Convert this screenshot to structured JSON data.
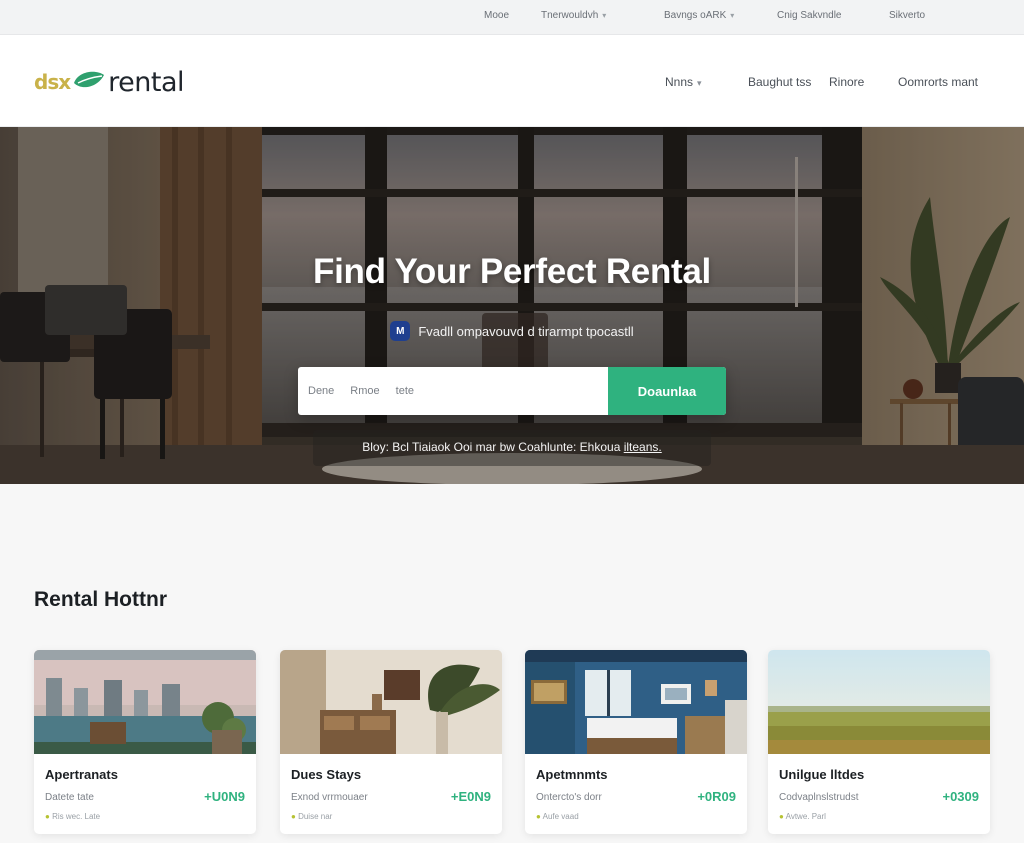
{
  "utility_bar": {
    "links": [
      {
        "label": "Mooe",
        "has_chevron": false
      },
      {
        "label": "Tnerwouldvh",
        "has_chevron": true
      },
      {
        "label": "Bavngs oARK",
        "has_chevron": true
      },
      {
        "label": "Cnig Sakvndle",
        "has_chevron": false
      },
      {
        "label": "Sikverto",
        "has_chevron": false
      }
    ]
  },
  "header": {
    "logo_prefix": "dsx",
    "logo_word": "rental",
    "nav": [
      {
        "label": "Nnns",
        "has_chevron": true
      },
      {
        "label": "Baughut tss",
        "has_chevron": false
      },
      {
        "label": "Rinore",
        "has_chevron": false
      },
      {
        "label": "Oomrorts mant",
        "has_chevron": false
      }
    ]
  },
  "hero": {
    "title": "Find Your Perfect Rental",
    "badge_letter": "M",
    "subtitle": "Fvadll  ompavouvd d  tirarmpt tpocastll",
    "search": {
      "field_1": "Dene",
      "field_2": "Rmoe",
      "field_3": "tete",
      "button_label": "Doaunlaa"
    },
    "links_text": "Bloy: Bcl Tiaiaok Ooi mar bw Coahlunte: Ehkoua ",
    "links_link": "ilteans."
  },
  "listings": {
    "section_title": "Rental Hottnr",
    "cards": [
      {
        "title": "Apertranats",
        "subtitle": "Datete tate",
        "price": "+U0N9",
        "meta": "Ris wec. Late"
      },
      {
        "title": "Dues Stays",
        "subtitle": "Exnod vrrmouaer",
        "price": "+E0N9",
        "meta": "Duise nar"
      },
      {
        "title": "Apetmnmts",
        "subtitle": "Ontercto's dorr",
        "price": "+0R09",
        "meta": "Aufe vaad"
      },
      {
        "title": "Unilgue lltdes",
        "subtitle": "Codvaplnslstrudst",
        "price": "+0309",
        "meta": "Avtwe. Parl"
      }
    ]
  },
  "colors": {
    "accent_green": "#2fb27f",
    "logo_gold": "#c9b24a",
    "badge_blue": "#1f3f8f"
  }
}
